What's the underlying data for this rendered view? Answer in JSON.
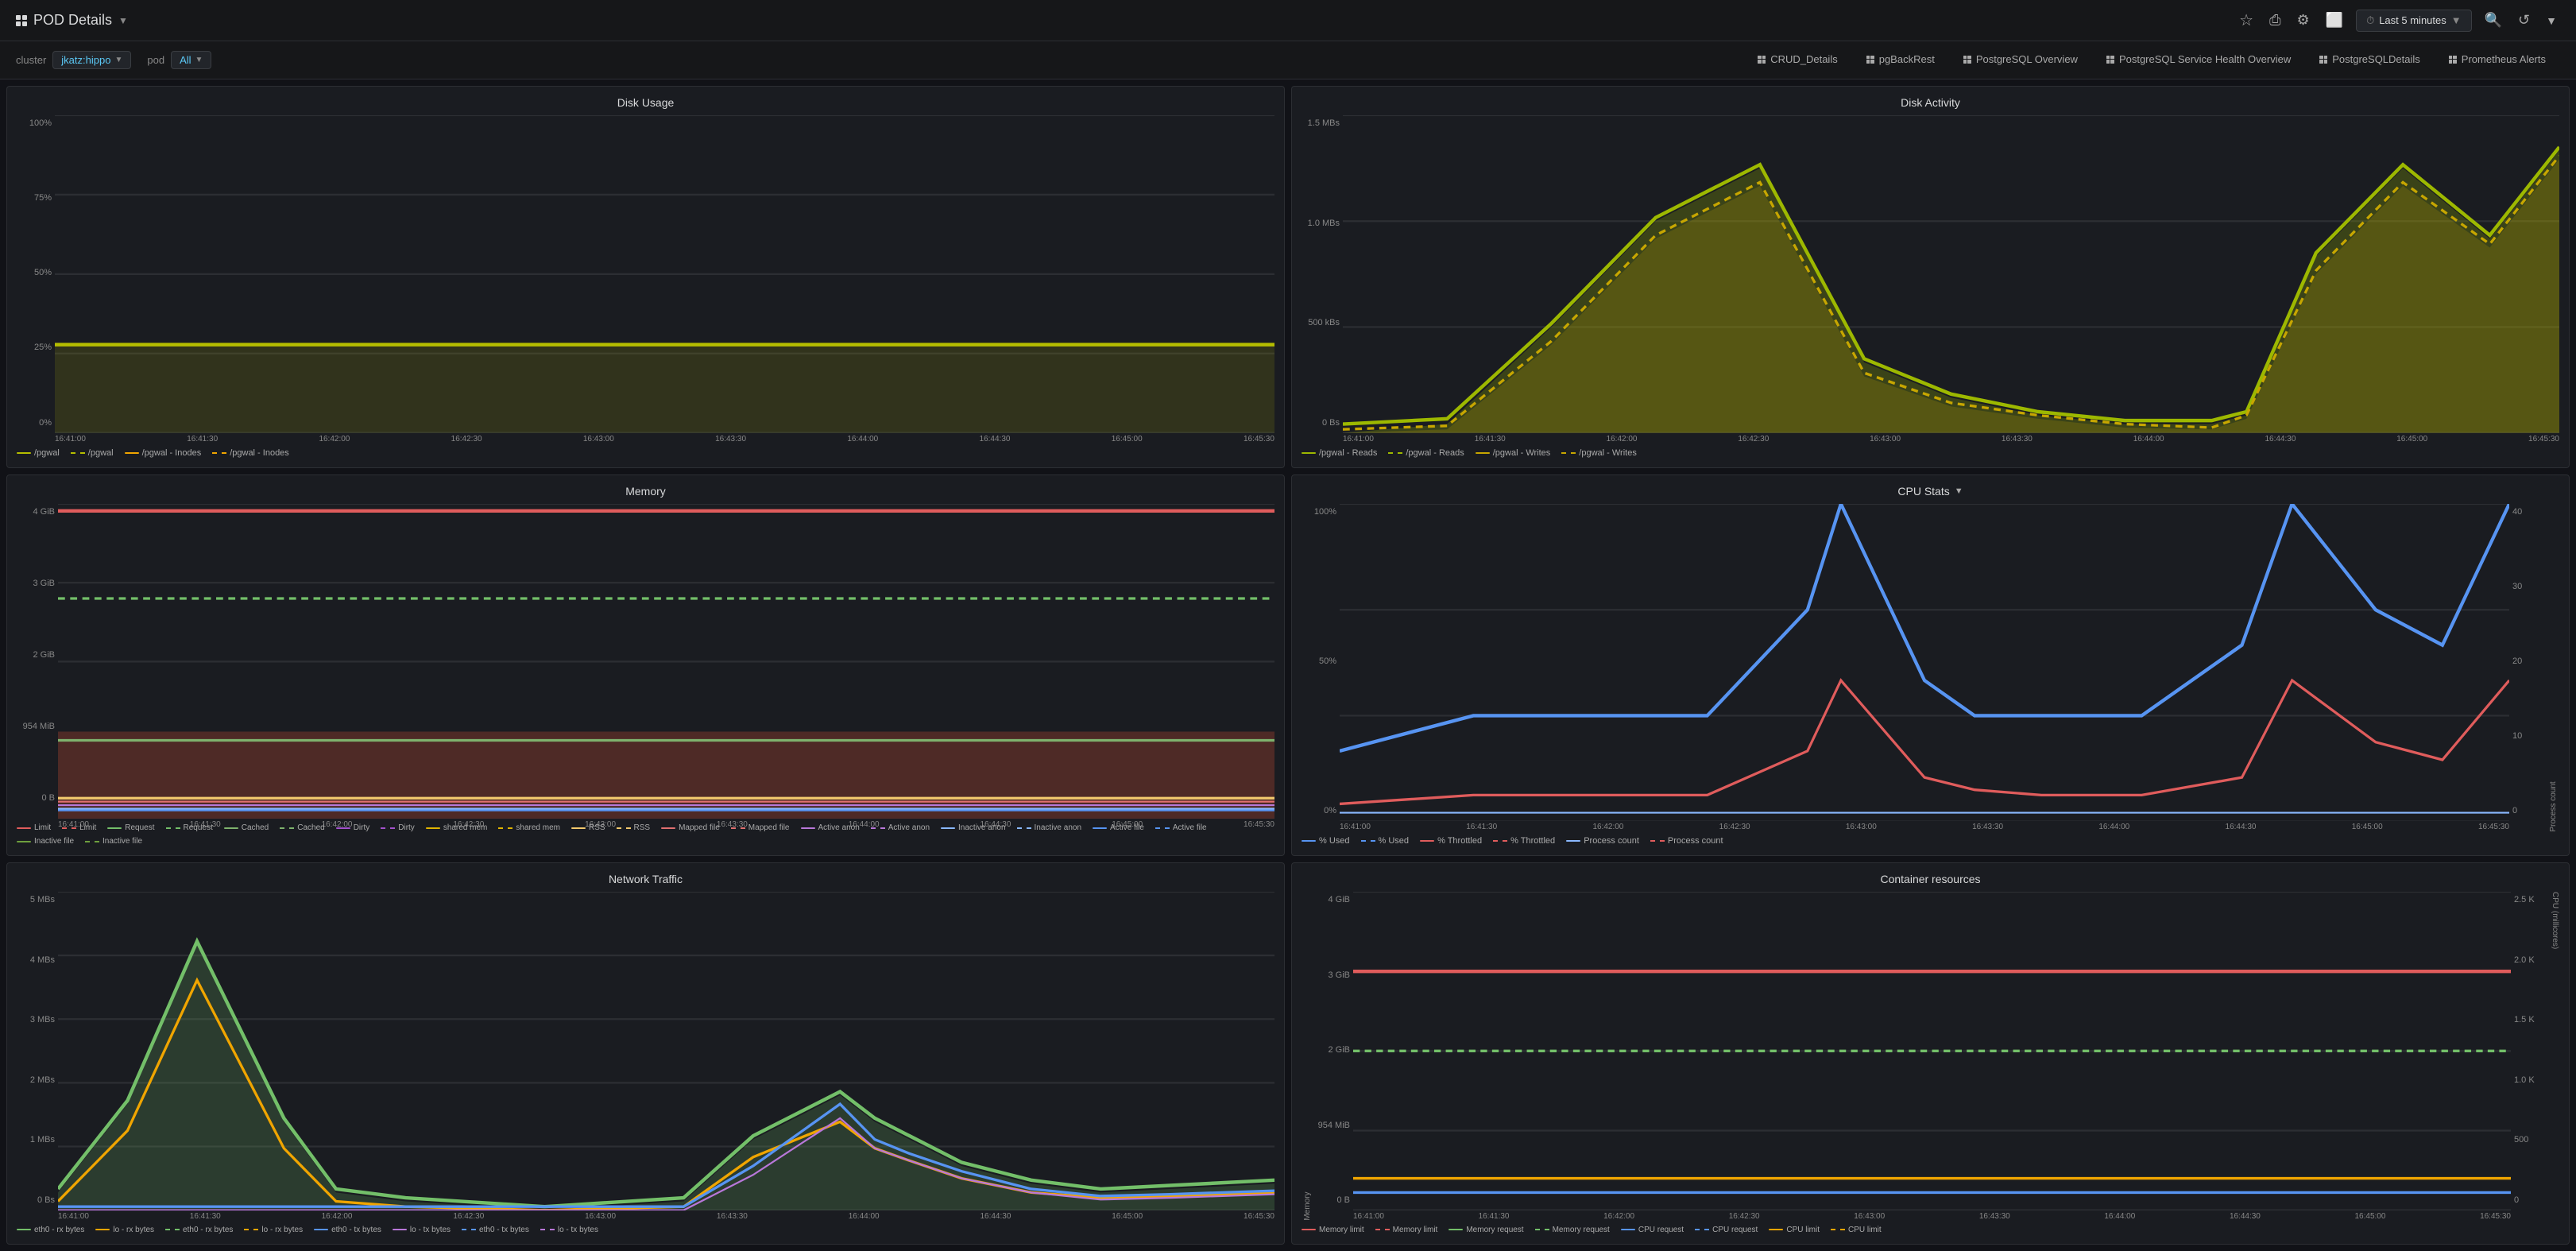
{
  "header": {
    "title": "POD Details",
    "title_caret": "▼",
    "time_range": "Last 5 minutes",
    "icons": {
      "star": "☆",
      "share": "⎙",
      "settings": "⚙",
      "monitor": "⬜",
      "search": "🔍",
      "refresh": "↺",
      "caret": "▼"
    }
  },
  "nav": {
    "cluster_label": "cluster",
    "cluster_value": "jkatz:hippo",
    "pod_label": "pod",
    "pod_value": "All",
    "links": [
      {
        "id": "crud-details",
        "label": "CRUD_Details"
      },
      {
        "id": "pgbackrest",
        "label": "pgBackRest"
      },
      {
        "id": "postgresql-overview",
        "label": "PostgreSQL Overview"
      },
      {
        "id": "postgresql-service-health",
        "label": "PostgreSQL Service Health Overview"
      },
      {
        "id": "postgresql-details",
        "label": "PostgreSQLDetails"
      },
      {
        "id": "prometheus-alerts",
        "label": "Prometheus Alerts"
      }
    ]
  },
  "charts": {
    "disk_usage": {
      "title": "Disk Usage",
      "y_labels": [
        "100%",
        "75%",
        "50%",
        "25%",
        "0%"
      ],
      "x_labels": [
        "16:41:00",
        "16:41:30",
        "16:42:00",
        "16:42:30",
        "16:43:00",
        "16:43:30",
        "16:44:00",
        "16:44:30",
        "16:45:00",
        "16:45:30"
      ],
      "legend": [
        {
          "label": "/pgwal",
          "color": "#b5bd00",
          "style": "solid"
        },
        {
          "label": "/pgwal",
          "color": "#b5bd00",
          "style": "dash"
        },
        {
          "label": "/pgwal - Inodes",
          "color": "#f0a500",
          "style": "solid"
        },
        {
          "label": "/pgwal - Inodes",
          "color": "#f0a500",
          "style": "dash"
        }
      ]
    },
    "disk_activity": {
      "title": "Disk Activity",
      "y_labels": [
        "1.5 MBs",
        "1.0 MBs",
        "500 kBs",
        "0 Bs"
      ],
      "x_labels": [
        "16:41:00",
        "16:41:30",
        "16:42:00",
        "16:42:30",
        "16:43:00",
        "16:43:30",
        "16:44:00",
        "16:44:30",
        "16:45:00",
        "16:45:30"
      ],
      "legend": [
        {
          "label": "/pgwal - Reads",
          "color": "#9db800",
          "style": "solid"
        },
        {
          "label": "/pgwal - Reads",
          "color": "#9db800",
          "style": "dash"
        },
        {
          "label": "/pgwal - Writes",
          "color": "#c7a600",
          "style": "solid"
        },
        {
          "label": "/pgwal - Writes",
          "color": "#c7a600",
          "style": "dash"
        }
      ]
    },
    "memory": {
      "title": "Memory",
      "y_labels": [
        "4 GiB",
        "3 GiB",
        "2 GiB",
        "954 MiB",
        "0 B"
      ],
      "x_labels": [
        "16:41:00",
        "16:41:30",
        "16:42:00",
        "16:42:30",
        "16:43:00",
        "16:43:30",
        "16:44:00",
        "16:44:30",
        "16:45:00",
        "16:45:30"
      ],
      "legend": [
        {
          "label": "Limit",
          "color": "#e05c5c",
          "style": "solid"
        },
        {
          "label": "Limit",
          "color": "#e05c5c",
          "style": "dash"
        },
        {
          "label": "Request",
          "color": "#73bf69",
          "style": "solid"
        },
        {
          "label": "Request",
          "color": "#73bf69",
          "style": "dash"
        },
        {
          "label": "Cached",
          "color": "#7eb26d",
          "style": "solid"
        },
        {
          "label": "Cached",
          "color": "#7eb26d",
          "style": "dash"
        },
        {
          "label": "Dirty",
          "color": "#a352cc",
          "style": "solid"
        },
        {
          "label": "Dirty",
          "color": "#a352cc",
          "style": "dash"
        },
        {
          "label": "shared mem",
          "color": "#e0b400",
          "style": "solid"
        },
        {
          "label": "shared mem",
          "color": "#e0b400",
          "style": "dash"
        },
        {
          "label": "RSS",
          "color": "#f2c96d",
          "style": "solid"
        },
        {
          "label": "RSS",
          "color": "#f2c96d",
          "style": "dash"
        },
        {
          "label": "Mapped file",
          "color": "#e07070",
          "style": "solid"
        },
        {
          "label": "Mapped file",
          "color": "#e07070",
          "style": "dash"
        },
        {
          "label": "Active anon",
          "color": "#b877d9",
          "style": "solid"
        },
        {
          "label": "Active anon",
          "color": "#b877d9",
          "style": "dash"
        },
        {
          "label": "Inactive anon",
          "color": "#8ab8ff",
          "style": "solid"
        },
        {
          "label": "Inactive anon",
          "color": "#8ab8ff",
          "style": "dash"
        },
        {
          "label": "Active file",
          "color": "#5794f2",
          "style": "solid"
        },
        {
          "label": "Active file",
          "color": "#5794f2",
          "style": "dash"
        },
        {
          "label": "Inactive file",
          "color": "#6e9f3e",
          "style": "solid"
        },
        {
          "label": "Inactive file",
          "color": "#6e9f3e",
          "style": "dash"
        }
      ]
    },
    "cpu_stats": {
      "title": "CPU Stats",
      "has_dropdown": true,
      "y_labels_left": [
        "100%",
        "50%",
        "0%"
      ],
      "y_labels_right": [
        "40",
        "30",
        "20",
        "10",
        "0"
      ],
      "right_axis_label": "Process count",
      "x_labels": [
        "16:41:00",
        "16:41:30",
        "16:42:00",
        "16:42:30",
        "16:43:00",
        "16:43:30",
        "16:44:00",
        "16:44:30",
        "16:45:00",
        "16:45:30"
      ],
      "legend": [
        {
          "label": "% Used",
          "color": "#5794f2",
          "style": "solid"
        },
        {
          "label": "% Used",
          "color": "#5794f2",
          "style": "dash"
        },
        {
          "label": "% Throttled",
          "color": "#e05c5c",
          "style": "solid"
        },
        {
          "label": "% Throttled",
          "color": "#e05c5c",
          "style": "dash"
        },
        {
          "label": "Process count",
          "color": "#8ab8ff",
          "style": "solid"
        },
        {
          "label": "Process count",
          "color": "#e05c5c",
          "style": "dash"
        }
      ],
      "legend2": [
        {
          "label": "Used",
          "color": "#e05c5c"
        },
        {
          "label": "Throttled",
          "color": "#e05c5c"
        }
      ]
    },
    "network_traffic": {
      "title": "Network Traffic",
      "y_labels": [
        "5 MBs",
        "4 MBs",
        "3 MBs",
        "2 MBs",
        "1 MBs",
        "0 Bs"
      ],
      "x_labels": [
        "16:41:00",
        "16:41:30",
        "16:42:00",
        "16:42:30",
        "16:43:00",
        "16:43:30",
        "16:44:00",
        "16:44:30",
        "16:45:00",
        "16:45:30"
      ],
      "legend": [
        {
          "label": "eth0 - rx bytes",
          "color": "#73bf69",
          "style": "solid"
        },
        {
          "label": "lo - rx bytes",
          "color": "#f0a500",
          "style": "solid"
        },
        {
          "label": "eth0 - rx bytes",
          "color": "#73bf69",
          "style": "dash"
        },
        {
          "label": "lo - rx bytes",
          "color": "#f0a500",
          "style": "dash"
        },
        {
          "label": "eth0 - tx bytes",
          "color": "#5794f2",
          "style": "solid"
        },
        {
          "label": "lo - tx bytes",
          "color": "#b877d9",
          "style": "solid"
        },
        {
          "label": "eth0 - tx bytes",
          "color": "#5794f2",
          "style": "dash"
        },
        {
          "label": "lo - tx bytes",
          "color": "#b877d9",
          "style": "dash"
        }
      ]
    },
    "container_resources": {
      "title": "Container resources",
      "y_labels_left": [
        "4 GiB",
        "3 GiB",
        "2 GiB",
        "954 MiB",
        "0 B"
      ],
      "y_labels_right": [
        "2.5 K",
        "2.0 K",
        "1.5 K",
        "1.0 K",
        "500",
        "0"
      ],
      "left_axis_label": "Memory",
      "right_axis_label": "CPU (millicores)",
      "x_labels": [
        "16:41:00",
        "16:41:30",
        "16:42:00",
        "16:42:30",
        "16:43:00",
        "16:43:30",
        "16:44:00",
        "16:44:30",
        "16:45:00",
        "16:45:30"
      ],
      "legend": [
        {
          "label": "Memory limit",
          "color": "#e05c5c",
          "style": "solid"
        },
        {
          "label": "Memory limit",
          "color": "#e05c5c",
          "style": "dash"
        },
        {
          "label": "Memory request",
          "color": "#73bf69",
          "style": "solid"
        },
        {
          "label": "Memory request",
          "color": "#73bf69",
          "style": "dash"
        },
        {
          "label": "CPU request",
          "color": "#5794f2",
          "style": "solid"
        },
        {
          "label": "CPU request",
          "color": "#5794f2",
          "style": "dash"
        },
        {
          "label": "CPU limit",
          "color": "#f0a500",
          "style": "solid"
        },
        {
          "label": "CPU limit",
          "color": "#f0a500",
          "style": "dash"
        }
      ]
    }
  }
}
